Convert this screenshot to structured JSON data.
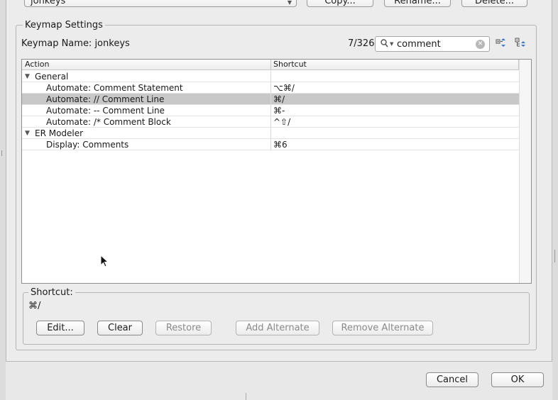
{
  "top_bar": {
    "keymap_select": "jonkeys",
    "copy_label": "Copy...",
    "rename_label": "Rename...",
    "delete_label": "Delete..."
  },
  "keymap_settings": {
    "group_title": "Keymap Settings",
    "keymap_name": "Keymap Name: jonkeys",
    "match_count": "7/326",
    "search": {
      "value": "comment"
    },
    "toolbar_icons": [
      "expand-all-icon",
      "collapse-all-icon"
    ]
  },
  "table": {
    "columns": [
      "Action",
      "Shortcut"
    ],
    "rows": [
      {
        "type": "category",
        "action": "General",
        "shortcut": ""
      },
      {
        "type": "item",
        "action": "Automate: Comment Statement",
        "shortcut": "⌥⌘/"
      },
      {
        "type": "item",
        "action": "Automate: // Comment Line",
        "shortcut": "⌘/",
        "selected": true
      },
      {
        "type": "item",
        "action": "Automate: -- Comment Line",
        "shortcut": "⌘-"
      },
      {
        "type": "item",
        "action": "Automate: /* Comment Block",
        "shortcut": "^⇧/"
      },
      {
        "type": "category",
        "action": "ER Modeler",
        "shortcut": ""
      },
      {
        "type": "item",
        "action": "Display: Comments",
        "shortcut": "⌘6"
      }
    ]
  },
  "shortcut_panel": {
    "title": "Shortcut:",
    "value": "⌘/",
    "buttons": {
      "edit": "Edit...",
      "clear": "Clear",
      "restore": "Restore",
      "add_alternate": "Add Alternate",
      "remove_alternate": "Remove Alternate"
    }
  },
  "footer": {
    "cancel": "Cancel",
    "ok": "OK"
  }
}
